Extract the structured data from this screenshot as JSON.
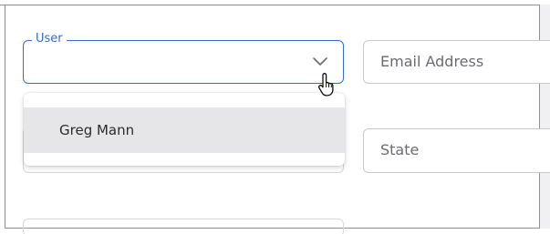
{
  "form": {
    "user_select": {
      "label": "User",
      "value": ""
    },
    "email_field": {
      "placeholder": "Email Address"
    },
    "state_field": {
      "placeholder": "State"
    }
  },
  "dropdown": {
    "options": [
      {
        "label": "Greg Mann"
      }
    ]
  },
  "icons": {
    "select_chevron": "chevron-down-icon",
    "cursor": "hand-pointer-cursor-icon"
  },
  "colors": {
    "accent": "#2f6bdc",
    "hover_bg": "#e6e6e8",
    "placeholder": "#6b6b70"
  }
}
